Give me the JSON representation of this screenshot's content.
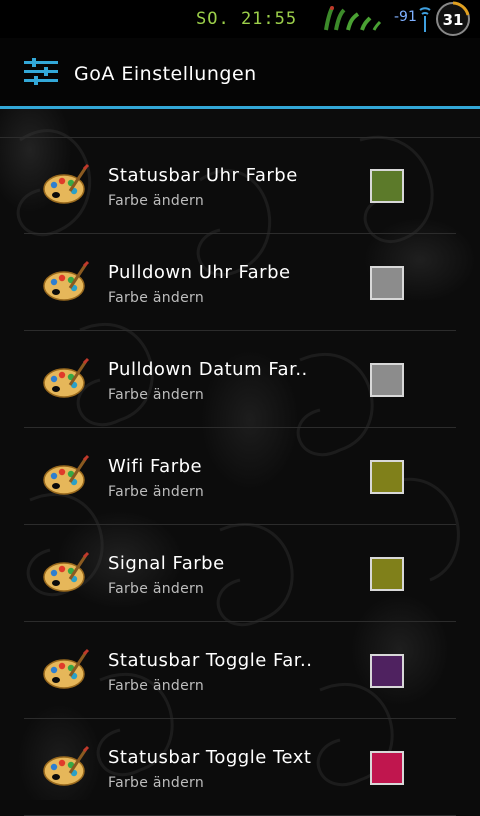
{
  "status_bar": {
    "time": "SO. 21:55",
    "signal_text": "-91",
    "battery_level": "31",
    "signal_icon": "signal-bars-icon",
    "wifi_icon": "wifi-icon"
  },
  "action_bar": {
    "title": "GoA Einstellungen",
    "icon": "settings-sliders-icon",
    "accent": "#33a8d8"
  },
  "items": [
    {
      "title": "Statusbar Uhr Farbe",
      "subtitle": "Farbe ändern",
      "color": "#5c7a2a"
    },
    {
      "title": "Pulldown Uhr Farbe",
      "subtitle": "Farbe ändern",
      "color": "#8c8c8c"
    },
    {
      "title": "Pulldown Datum Far..",
      "subtitle": "Farbe ändern",
      "color": "#8c8c8c"
    },
    {
      "title": "Wifi Farbe",
      "subtitle": "Farbe ändern",
      "color": "#80801a"
    },
    {
      "title": "Signal Farbe",
      "subtitle": "Farbe ändern",
      "color": "#80801a"
    },
    {
      "title": "Statusbar Toggle Far..",
      "subtitle": "Farbe ändern",
      "color": "#4f2260"
    },
    {
      "title": "Statusbar Toggle Text",
      "subtitle": "Farbe ändern",
      "color": "#c0164e"
    }
  ]
}
